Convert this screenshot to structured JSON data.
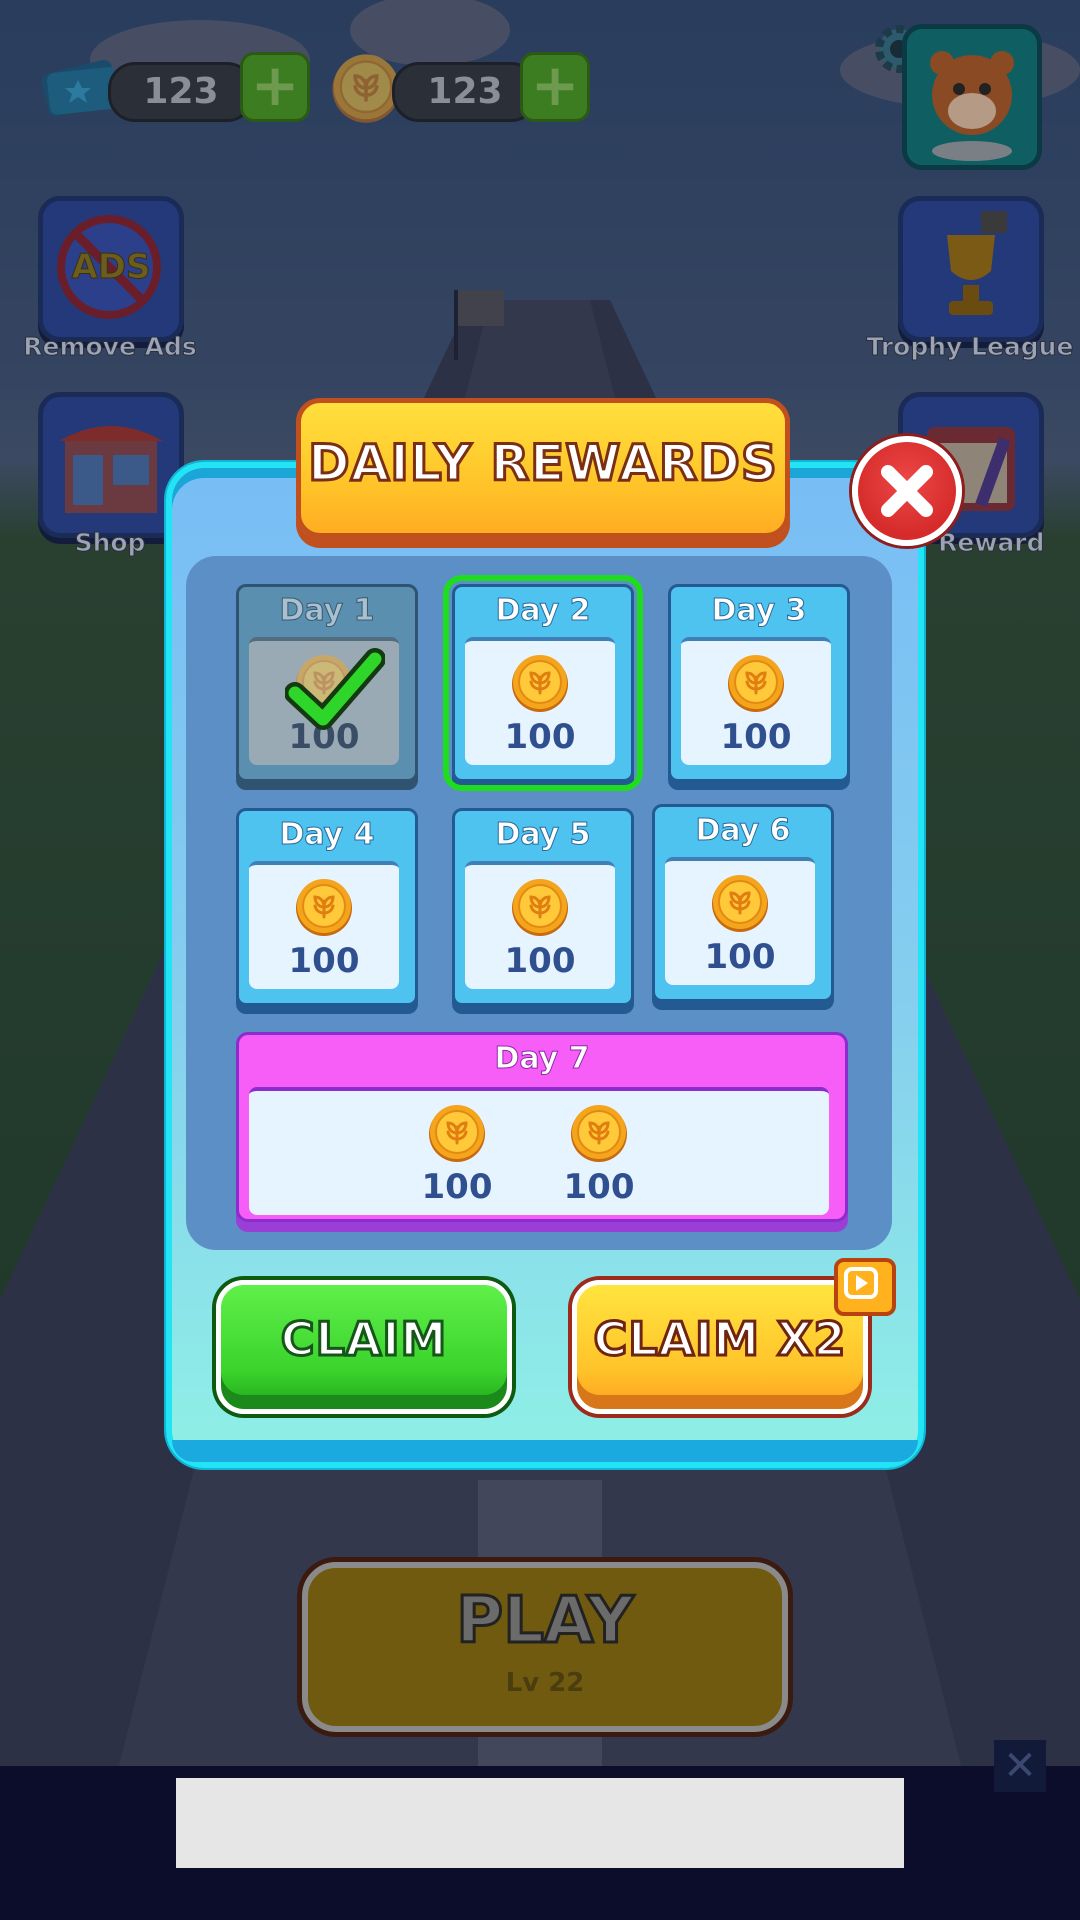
{
  "topbar": {
    "tickets_count": "123",
    "coins_count": "123"
  },
  "side_buttons": {
    "remove_ads": {
      "label": "Remove Ads",
      "badge": "ADS"
    },
    "shop": {
      "label": "Shop"
    },
    "trophy_league": {
      "label": "Trophy League"
    },
    "daily_reward": {
      "label": "Daily Reward",
      "visible_label": "ily Reward"
    }
  },
  "dialog": {
    "title": "DAILY REWARDS",
    "days": [
      {
        "label": "Day 1",
        "amount": "100",
        "state": "claimed"
      },
      {
        "label": "Day 2",
        "amount": "100",
        "state": "current"
      },
      {
        "label": "Day 3",
        "amount": "100",
        "state": "locked"
      },
      {
        "label": "Day 4",
        "amount": "100",
        "state": "locked"
      },
      {
        "label": "Day 5",
        "amount": "100",
        "state": "locked"
      },
      {
        "label": "Day 6",
        "amount": "100",
        "state": "locked"
      }
    ],
    "day7": {
      "label": "Day 7",
      "amounts": [
        "100",
        "100"
      ]
    },
    "claim_label": "CLAIM",
    "claim_x2_label": "CLAIM X2"
  },
  "play": {
    "label": "PLAY",
    "level": "Lv 22"
  },
  "colors": {
    "accent_green": "#3ad22c",
    "accent_yellow": "#ffc22a",
    "dialog_border": "#22e4f4",
    "day7_pink": "#f75df7",
    "close_red": "#d52b2b"
  },
  "icons": [
    "ticket-icon",
    "coin-icon",
    "plus-icon",
    "gear-icon",
    "tiger-avatar-icon",
    "no-ads-icon",
    "shop-icon",
    "trophy-icon",
    "calendar-icon",
    "checkmark-icon",
    "close-icon",
    "video-play-icon"
  ]
}
